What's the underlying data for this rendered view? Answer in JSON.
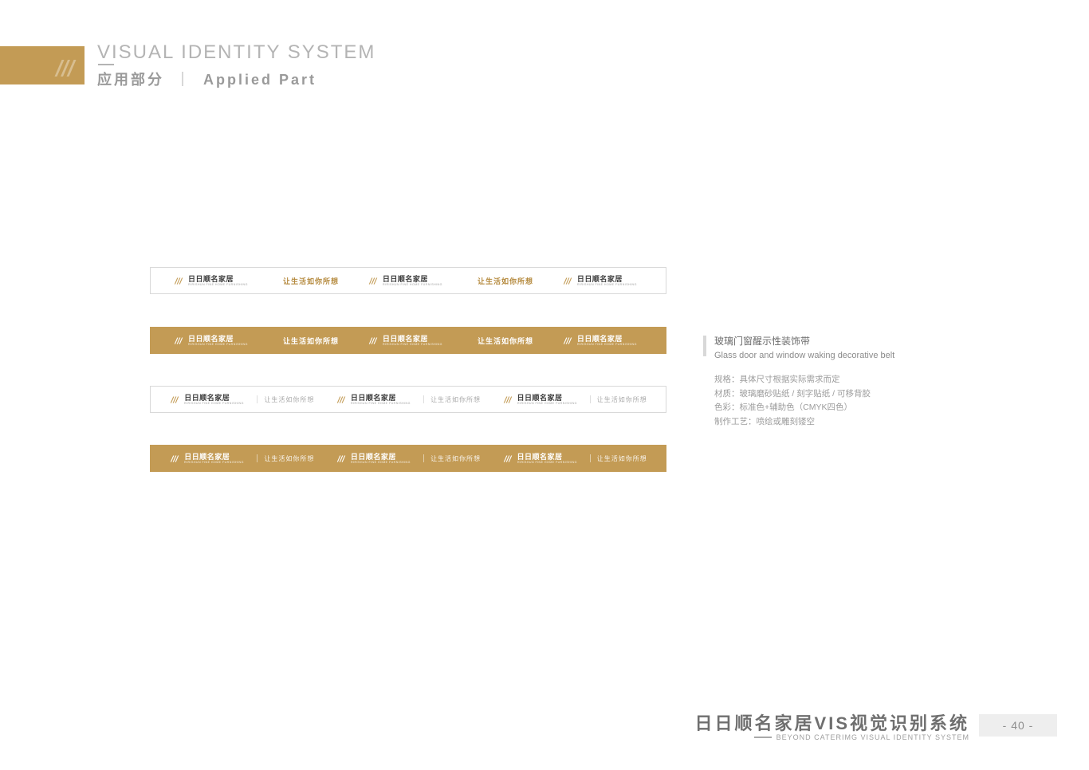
{
  "header": {
    "title_en": "VISUAL IDENTITY SYSTEM",
    "title_cn": "应用部分",
    "title_sep": "｜",
    "title_sub": "Applied Part"
  },
  "logo": {
    "name": "日日顺名家居",
    "sub": "RIRISHUN FINE HOME FURNISHING"
  },
  "slogan": "让生活如你所想",
  "info": {
    "title_cn": "玻璃门窗醒示性装饰带",
    "title_en": "Glass door and window waking decorative belt",
    "specs": [
      "规格：具体尺寸根据实际需求而定",
      "材质：玻璃磨砂贴纸 / 刻字贴纸 / 可移背胶",
      "色彩：标准色+辅助色（CMYK四色）",
      "制作工艺：喷绘或雕刻镂空"
    ]
  },
  "footer": {
    "brand_cn": "日日顺名家居VIS视觉识别系统",
    "brand_en": "BEYOND CATERIMG VISUAL IDENTITY SYSTEM",
    "page": "- 40 -"
  },
  "colors": {
    "gold": "#c39b55"
  }
}
